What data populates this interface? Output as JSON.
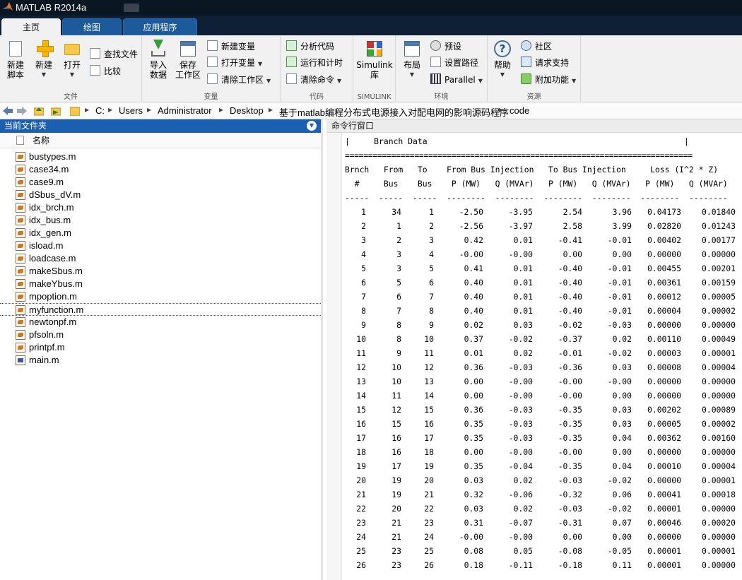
{
  "window": {
    "title": "MATLAB R2014a"
  },
  "tabs": [
    {
      "label": "主页",
      "active": true
    },
    {
      "label": "绘图",
      "active": false
    },
    {
      "label": "应用程序",
      "active": false
    }
  ],
  "ribbon": {
    "file": {
      "group_label": "文件",
      "new_script": "新建\n脚本",
      "new": "新建",
      "open": "打开",
      "find_files": "查找文件",
      "compare": "比较"
    },
    "variable": {
      "group_label": "变量",
      "import_data": "导入\n数据",
      "save_workspace": "保存\n工作区",
      "new_variable": "新建变量",
      "open_variable": "打开变量",
      "clear_workspace": "清除工作区"
    },
    "code": {
      "group_label": "代码",
      "analyze_code": "分析代码",
      "run_and_time": "运行和计时",
      "clear_commands": "清除命令"
    },
    "simulink": {
      "group_label": "SIMULINK",
      "library": "Simulink\n库"
    },
    "environment": {
      "group_label": "环境",
      "layout": "布局",
      "preferences": "预设",
      "set_path": "设置路径",
      "parallel": "Parallel"
    },
    "resources": {
      "group_label": "资源",
      "help": "帮助",
      "community": "社区",
      "request_support": "请求支持",
      "add_ons": "附加功能"
    }
  },
  "address": {
    "crumbs": [
      "C:",
      "Users",
      "Administrator",
      "Desktop",
      "基于matlab编程分布式电源接入对配电网的影响源码程序",
      "code"
    ]
  },
  "current_folder": {
    "title": "当前文件夹",
    "column_name": "名称",
    "files": [
      {
        "name": "bustypes.m",
        "selected": false
      },
      {
        "name": "case34.m",
        "selected": false
      },
      {
        "name": "case9.m",
        "selected": false
      },
      {
        "name": "dSbus_dV.m",
        "selected": false
      },
      {
        "name": "idx_brch.m",
        "selected": false
      },
      {
        "name": "idx_bus.m",
        "selected": false
      },
      {
        "name": "idx_gen.m",
        "selected": false
      },
      {
        "name": "isload.m",
        "selected": false
      },
      {
        "name": "loadcase.m",
        "selected": false
      },
      {
        "name": "makeSbus.m",
        "selected": false
      },
      {
        "name": "makeYbus.m",
        "selected": false
      },
      {
        "name": "mpoption.m",
        "selected": false
      },
      {
        "name": "myfunction.m",
        "selected": true
      },
      {
        "name": "newtonpf.m",
        "selected": false
      },
      {
        "name": "pfsoln.m",
        "selected": false
      },
      {
        "name": "printpf.m",
        "selected": false
      },
      {
        "name": "main.m",
        "selected": false,
        "kind": "script"
      }
    ]
  },
  "command_window": {
    "title": "命令行窗口",
    "banner": "|     Branch Data                                                     |",
    "rule": "===========================================================================",
    "header1": "Brnch   From   To    From Bus Injection   To Bus Injection     Loss (I^2 * Z)",
    "header2": "  #     Bus    Bus    P (MW)   Q (MVAr)   P (MW)   Q (MVAr)   P (MW)   Q (MVAr)",
    "dashes": "-----  -----  -----  --------  --------  --------  --------  --------  --------",
    "columns": [
      "brnch",
      "from",
      "to",
      "pf",
      "qf",
      "pt",
      "qt",
      "ploss",
      "qloss"
    ],
    "rows": [
      [
        "1",
        "34",
        "1",
        "-2.50",
        "-3.95",
        "2.54",
        "3.96",
        "0.04173",
        "0.01840"
      ],
      [
        "2",
        "1",
        "2",
        "-2.56",
        "-3.97",
        "2.58",
        "3.99",
        "0.02820",
        "0.01243"
      ],
      [
        "3",
        "2",
        "3",
        "0.42",
        "0.01",
        "-0.41",
        "-0.01",
        "0.00402",
        "0.00177"
      ],
      [
        "4",
        "3",
        "4",
        "-0.00",
        "-0.00",
        "0.00",
        "0.00",
        "0.00000",
        "0.00000"
      ],
      [
        "5",
        "3",
        "5",
        "0.41",
        "0.01",
        "-0.40",
        "-0.01",
        "0.00455",
        "0.00201"
      ],
      [
        "6",
        "5",
        "6",
        "0.40",
        "0.01",
        "-0.40",
        "-0.01",
        "0.00361",
        "0.00159"
      ],
      [
        "7",
        "6",
        "7",
        "0.40",
        "0.01",
        "-0.40",
        "-0.01",
        "0.00012",
        "0.00005"
      ],
      [
        "8",
        "7",
        "8",
        "0.40",
        "0.01",
        "-0.40",
        "-0.01",
        "0.00004",
        "0.00002"
      ],
      [
        "9",
        "8",
        "9",
        "0.02",
        "0.03",
        "-0.02",
        "-0.03",
        "0.00000",
        "0.00000"
      ],
      [
        "10",
        "8",
        "10",
        "0.37",
        "-0.02",
        "-0.37",
        "0.02",
        "0.00110",
        "0.00049"
      ],
      [
        "11",
        "9",
        "11",
        "0.01",
        "0.02",
        "-0.01",
        "-0.02",
        "0.00003",
        "0.00001"
      ],
      [
        "12",
        "10",
        "12",
        "0.36",
        "-0.03",
        "-0.36",
        "0.03",
        "0.00008",
        "0.00004"
      ],
      [
        "13",
        "10",
        "13",
        "0.00",
        "-0.00",
        "-0.00",
        "-0.00",
        "0.00000",
        "0.00000"
      ],
      [
        "14",
        "11",
        "14",
        "0.00",
        "-0.00",
        "-0.00",
        "0.00",
        "0.00000",
        "0.00000"
      ],
      [
        "15",
        "12",
        "15",
        "0.36",
        "-0.03",
        "-0.35",
        "0.03",
        "0.00202",
        "0.00089"
      ],
      [
        "16",
        "15",
        "16",
        "0.35",
        "-0.03",
        "-0.35",
        "0.03",
        "0.00005",
        "0.00002"
      ],
      [
        "17",
        "16",
        "17",
        "0.35",
        "-0.03",
        "-0.35",
        "0.04",
        "0.00362",
        "0.00160"
      ],
      [
        "18",
        "16",
        "18",
        "0.00",
        "-0.00",
        "-0.00",
        "0.00",
        "0.00000",
        "0.00000"
      ],
      [
        "19",
        "17",
        "19",
        "0.35",
        "-0.04",
        "-0.35",
        "0.04",
        "0.00010",
        "0.00004"
      ],
      [
        "20",
        "19",
        "20",
        "0.03",
        "0.02",
        "-0.03",
        "-0.02",
        "0.00000",
        "0.00001"
      ],
      [
        "21",
        "19",
        "21",
        "0.32",
        "-0.06",
        "-0.32",
        "0.06",
        "0.00041",
        "0.00018"
      ],
      [
        "22",
        "20",
        "22",
        "0.03",
        "0.02",
        "-0.03",
        "-0.02",
        "0.00001",
        "0.00000"
      ],
      [
        "23",
        "21",
        "23",
        "0.31",
        "-0.07",
        "-0.31",
        "0.07",
        "0.00046",
        "0.00020"
      ],
      [
        "24",
        "21",
        "24",
        "-0.00",
        "-0.00",
        "0.00",
        "0.00",
        "0.00000",
        "0.00000"
      ],
      [
        "25",
        "23",
        "25",
        "0.08",
        "0.05",
        "-0.08",
        "-0.05",
        "0.00001",
        "0.00001"
      ],
      [
        "26",
        "23",
        "26",
        "0.18",
        "-0.11",
        "-0.18",
        "0.11",
        "0.00001",
        "0.00000"
      ]
    ]
  }
}
